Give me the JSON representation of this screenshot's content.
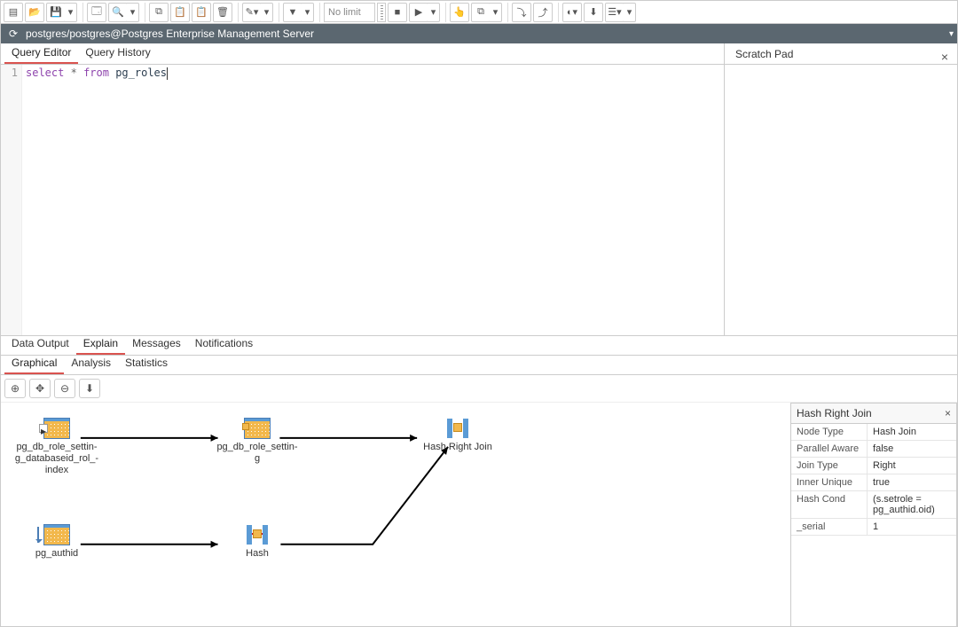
{
  "toolbar": {
    "no_limit": "No limit"
  },
  "connection": {
    "label": "postgres/postgres@Postgres Enterprise Management Server"
  },
  "editor_tabs": {
    "query_editor": "Query Editor",
    "query_history": "Query History"
  },
  "scratchpad": {
    "title": "Scratch Pad"
  },
  "sql": {
    "line_no": "1",
    "kw_select": "select",
    "star": "*",
    "kw_from": "from",
    "ident": "pg_roles"
  },
  "output_tabs": {
    "data_output": "Data Output",
    "explain": "Explain",
    "messages": "Messages",
    "notifications": "Notifications"
  },
  "explain_subtabs": {
    "graphical": "Graphical",
    "analysis": "Analysis",
    "statistics": "Statistics"
  },
  "plan_nodes": {
    "n1": "pg_db_role_settin-\ng_databaseid_rol_-\nindex",
    "n2": "pg_db_role_settin-\ng",
    "n3": "Hash Right Join",
    "n4": "pg_authid",
    "n5": "Hash"
  },
  "detail": {
    "title": "Hash Right Join",
    "rows": [
      {
        "k": "Node Type",
        "v": "Hash Join"
      },
      {
        "k": "Parallel Aware",
        "v": "false"
      },
      {
        "k": "Join Type",
        "v": "Right"
      },
      {
        "k": "Inner Unique",
        "v": "true"
      },
      {
        "k": "Hash Cond",
        "v": "(s.setrole = pg_authid.oid)"
      },
      {
        "k": "_serial",
        "v": "1"
      }
    ]
  }
}
